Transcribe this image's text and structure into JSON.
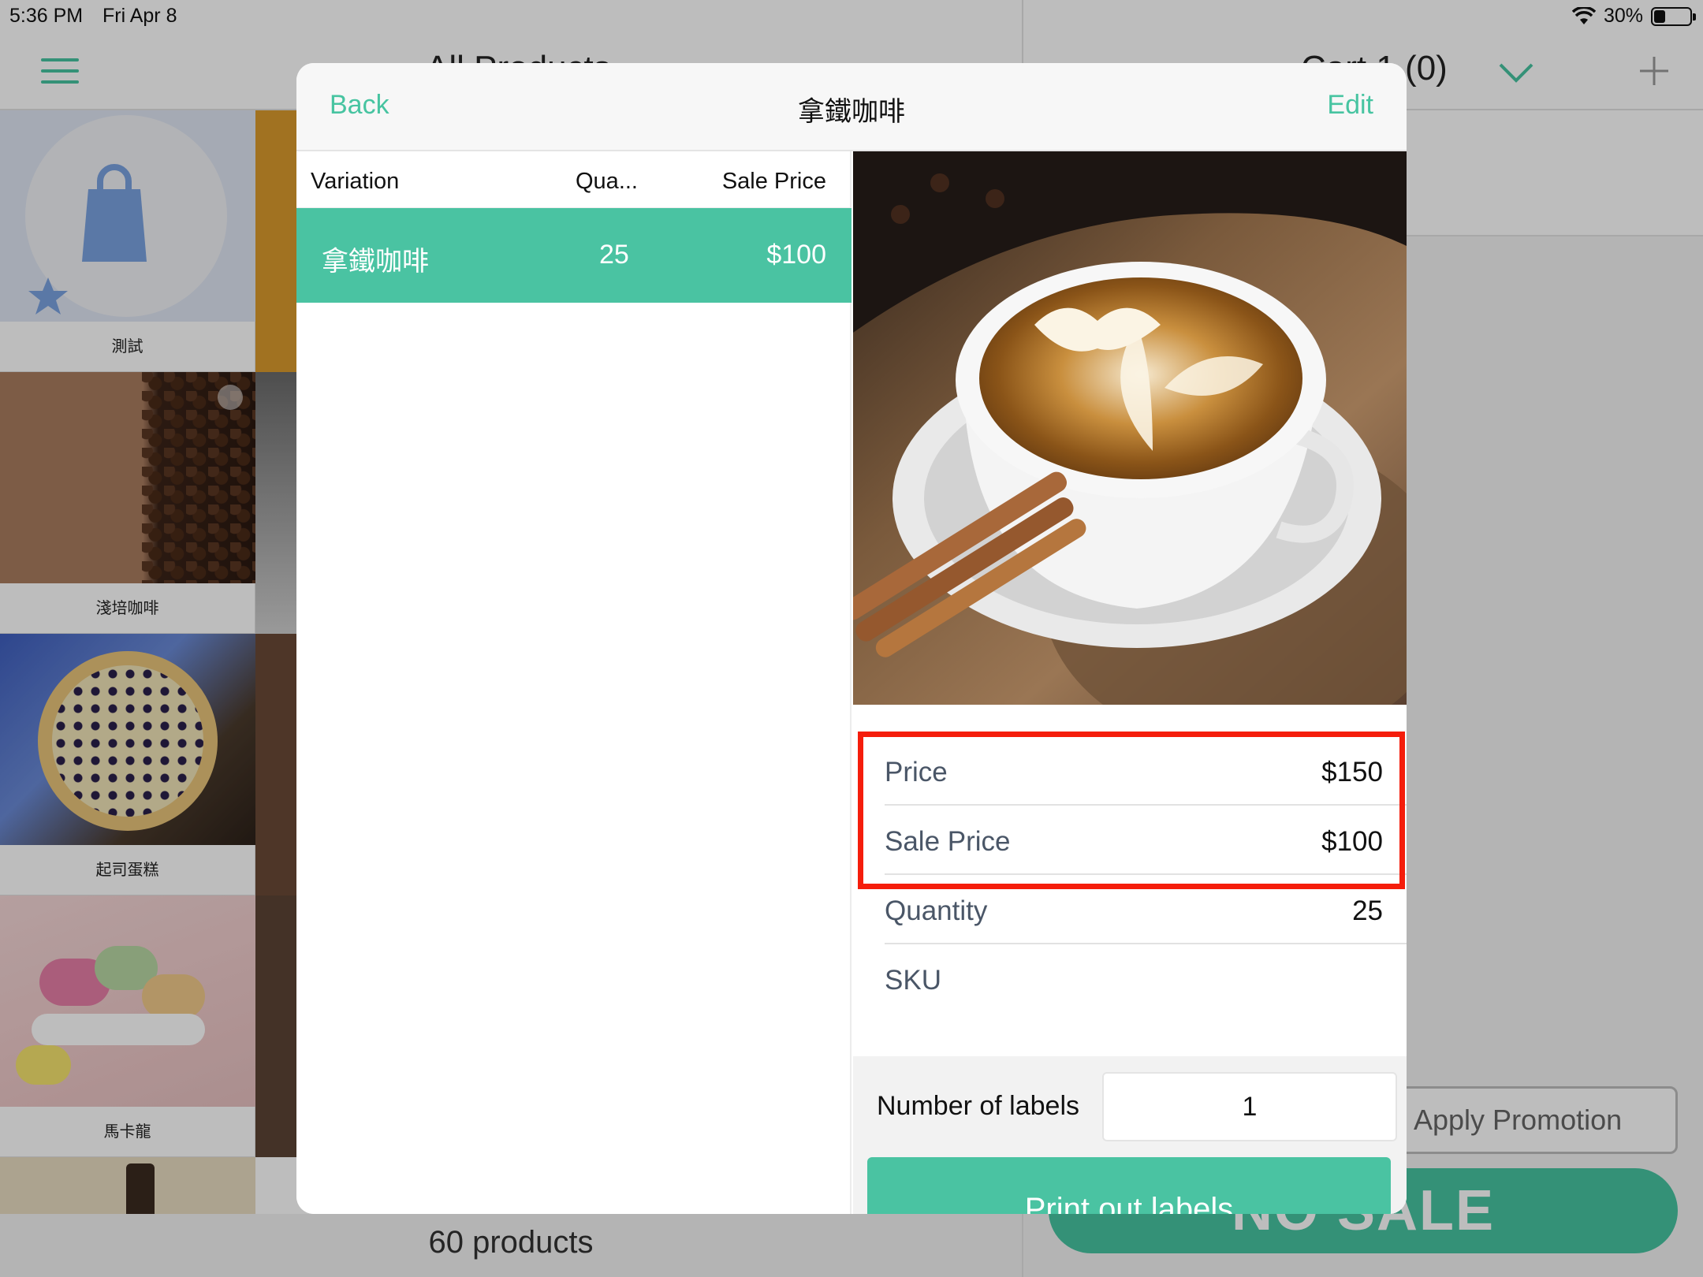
{
  "status_bar": {
    "time": "5:36 PM",
    "date": "Fri Apr 8",
    "battery": "30%",
    "battery_level": 0.3
  },
  "background": {
    "header_left": "All Products",
    "header_right": "Cart 1 (0)",
    "products": [
      {
        "name": "測試"
      },
      {
        "name": "淺培咖啡"
      },
      {
        "name": "起司蛋糕"
      },
      {
        "name": "馬卡龍"
      }
    ],
    "products_count": "60 products",
    "apply_promotion": "Apply Promotion",
    "no_sale": "NO SALE"
  },
  "modal": {
    "back_label": "Back",
    "title": "拿鐵咖啡",
    "edit_label": "Edit",
    "columns": {
      "variation": "Variation",
      "quantity": "Qua...",
      "sale_price": "Sale Price"
    },
    "variation_rows": [
      {
        "name": "拿鐵咖啡",
        "quantity": "25",
        "sale_price": "$100"
      }
    ],
    "details": [
      {
        "label": "Price",
        "value": "$150"
      },
      {
        "label": "Sale Price",
        "value": "$100"
      },
      {
        "label": "Quantity",
        "value": "25"
      },
      {
        "label": "SKU",
        "value": ""
      }
    ],
    "number_of_labels_label": "Number of labels",
    "number_of_labels_value": "1",
    "print_button": "Print out labels"
  },
  "colors": {
    "accent": "#47c4a1",
    "highlight": "#f51d0b"
  }
}
